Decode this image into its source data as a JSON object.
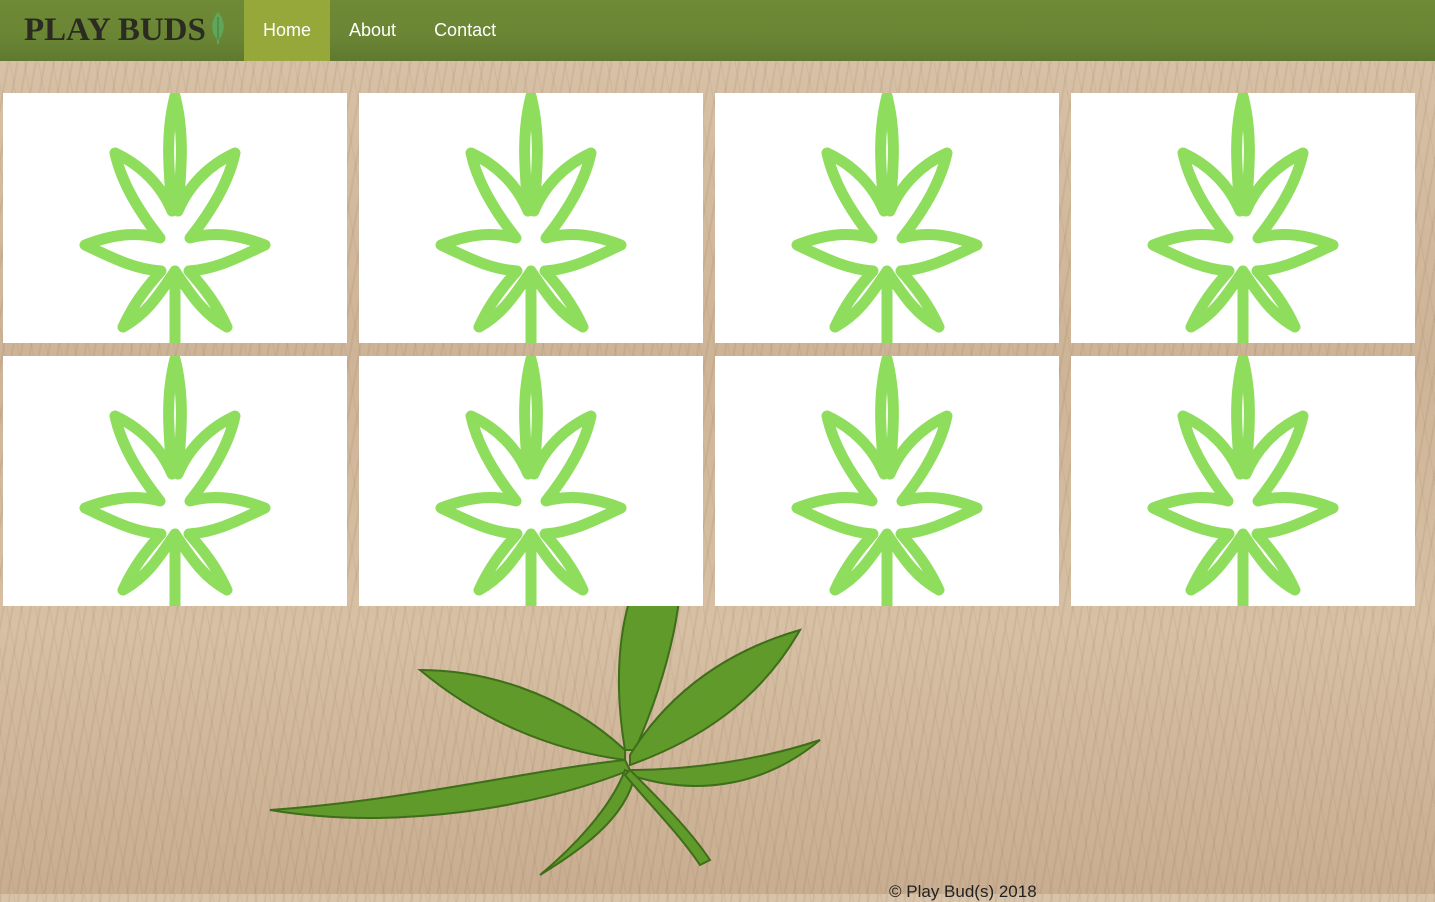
{
  "brand": {
    "name": "PLAY BUDS",
    "logo_icon": "leaf-icon"
  },
  "nav": {
    "items": [
      {
        "label": "Home",
        "active": true
      },
      {
        "label": "About",
        "active": false
      },
      {
        "label": "Contact",
        "active": false
      }
    ]
  },
  "cards": [
    {
      "icon": "cannabis-leaf-icon"
    },
    {
      "icon": "cannabis-leaf-icon"
    },
    {
      "icon": "cannabis-leaf-icon"
    },
    {
      "icon": "cannabis-leaf-icon"
    },
    {
      "icon": "cannabis-leaf-icon"
    },
    {
      "icon": "cannabis-leaf-icon"
    },
    {
      "icon": "cannabis-leaf-icon"
    },
    {
      "icon": "cannabis-leaf-icon"
    }
  ],
  "footer": {
    "copyright": "© Play Bud(s) 2018"
  },
  "colors": {
    "nav_bg": "#6a8534",
    "nav_active": "#96a83a",
    "leaf_green": "#8fdd5d"
  }
}
